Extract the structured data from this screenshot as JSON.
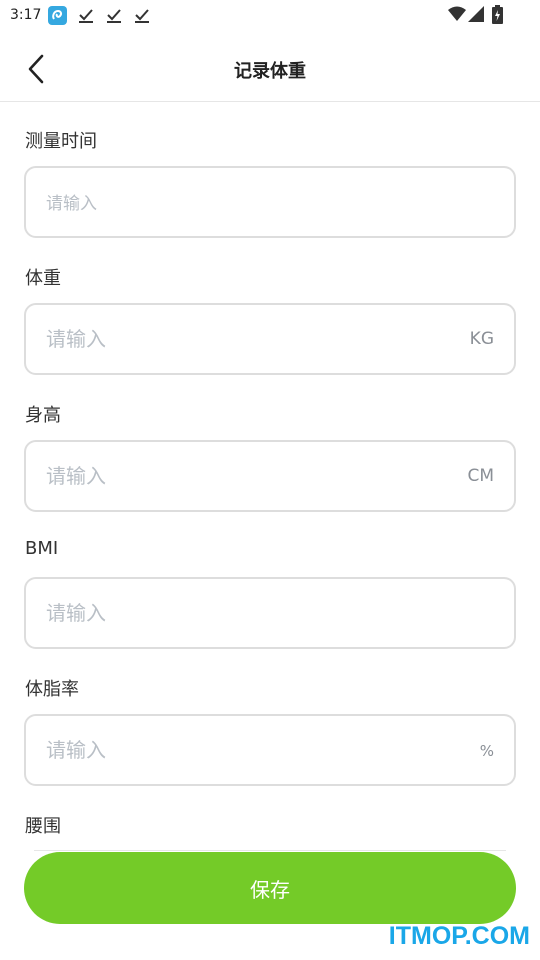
{
  "status_bar": {
    "time": "3:17"
  },
  "header": {
    "title": "记录体重"
  },
  "fields": [
    {
      "label": "测量时间",
      "placeholder": "请输入",
      "unit": ""
    },
    {
      "label": "体重",
      "placeholder": "请输入",
      "unit": "KG"
    },
    {
      "label": "身高",
      "placeholder": "请输入",
      "unit": "CM"
    },
    {
      "label": "BMI",
      "placeholder": "请输入",
      "unit": ""
    },
    {
      "label": "体脂率",
      "placeholder": "请输入",
      "unit": "%"
    },
    {
      "label": "腰围"
    }
  ],
  "save_button": {
    "label": "保存"
  },
  "watermark": "ITMOP.COM",
  "colors": {
    "accent": "#74cb28",
    "watermark": "#1aa7e8",
    "border": "#dddddd",
    "placeholder": "#b9bfc6"
  }
}
